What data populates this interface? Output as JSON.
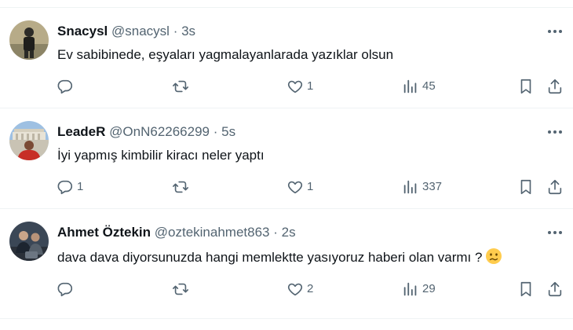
{
  "tweets": [
    {
      "name": "Snacysl",
      "handle": "@snacysl",
      "separator": "·",
      "time": "3s",
      "text": "Ev sabibinede, eşyaları yagmalayanlarada yazıklar olsun",
      "replies": "",
      "reposts": "",
      "likes": "1",
      "views": "45",
      "avatar_colors": [
        "#a89b7a",
        "#3a3a34"
      ]
    },
    {
      "name": "LeadeR",
      "handle": "@OnN62266299",
      "separator": "·",
      "time": "5s",
      "text": "İyi yapmış kimbilir kiracı neler yaptı",
      "replies": "1",
      "reposts": "",
      "likes": "1",
      "views": "337",
      "avatar_colors": [
        "#8fb3d9",
        "#c0302a"
      ]
    },
    {
      "name": "Ahmet Öztekin",
      "handle": "@oztekinahmet863",
      "separator": "·",
      "time": "2s",
      "text": "dava dava diyorsunuzda hangi memlektte yasıyoruz haberi olan varmı ?",
      "emoji": "confused-face-emoji",
      "replies": "",
      "reposts": "",
      "likes": "2",
      "views": "29",
      "avatar_colors": [
        "#2c3a4a",
        "#4a4f55"
      ]
    }
  ],
  "icons": {
    "reply": "reply-icon",
    "repost": "repost-icon",
    "like": "heart-icon",
    "views": "views-icon",
    "bookmark": "bookmark-icon",
    "share": "share-icon",
    "more": "more-icon"
  },
  "colors": {
    "text": "#0f1419",
    "secondary": "#536471",
    "divider": "#eff3f4"
  }
}
